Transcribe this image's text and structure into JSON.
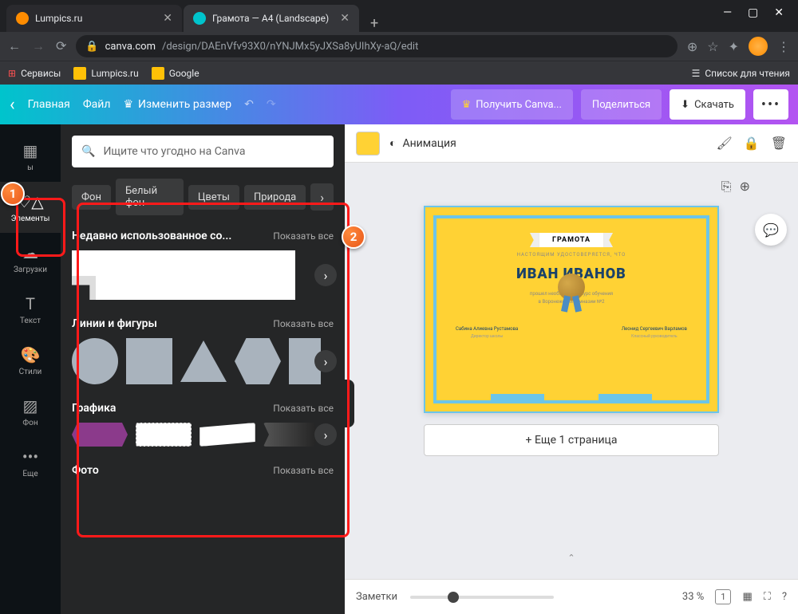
{
  "browser": {
    "tabs": [
      {
        "title": "Lumpics.ru",
        "favicon": "#ff8c00"
      },
      {
        "title": "Грамота — A4 (Landscape)",
        "favicon": "#00c4cc"
      }
    ],
    "url_host": "canva.com",
    "url_path": "/design/DAEnVfv93X0/nYNJMx5yJXSa8yUIhXy-aQ/edit",
    "bookmarks": {
      "services": "Сервисы",
      "items": [
        "Lumpics.ru",
        "Google"
      ],
      "reading_list": "Список для чтения"
    }
  },
  "topbar": {
    "back": "‹",
    "home": "Главная",
    "file": "Файл",
    "resize": "Изменить размер",
    "get_pro": "Получить Canva...",
    "share": "Поделиться",
    "download": "Скачать"
  },
  "rail": {
    "templates": "ы",
    "elements": "Элементы",
    "uploads": "Загрузки",
    "text": "Текст",
    "styles": "Стили",
    "background": "Фон",
    "more": "Еще"
  },
  "panel": {
    "search_placeholder": "Ищите что угодно на Canva",
    "chips": [
      "Фон",
      "Белый фон",
      "Цветы",
      "Природа"
    ],
    "recent_title": "Недавно использованное со...",
    "show_all": "Показать все",
    "lines_title": "Линии и фигуры",
    "graphics_title": "Графика",
    "photo_title": "Фото"
  },
  "canvas": {
    "animation": "Анимация",
    "add_page": "+ Еще 1 страница",
    "notes": "Заметки",
    "zoom": "33 %",
    "page_num": "1"
  },
  "certificate": {
    "header": "ГРАМОТА",
    "sub": "НАСТОЯЩИМ УДОСТОВЕРЯЕТСЯ, ЧТО",
    "name": "ИВАН ИВАНОВ",
    "desc1": "прошел необходимый курс обучения",
    "desc2": "в Воронежской гимназии №2",
    "sig1_name": "Сабина Алиевна Рустамова",
    "sig1_role": "Директор школы",
    "sig2_name": "Леонид Сергеевич Варламов",
    "sig2_role": "Классный руководитель"
  },
  "markers": {
    "m1": "1",
    "m2": "2"
  }
}
